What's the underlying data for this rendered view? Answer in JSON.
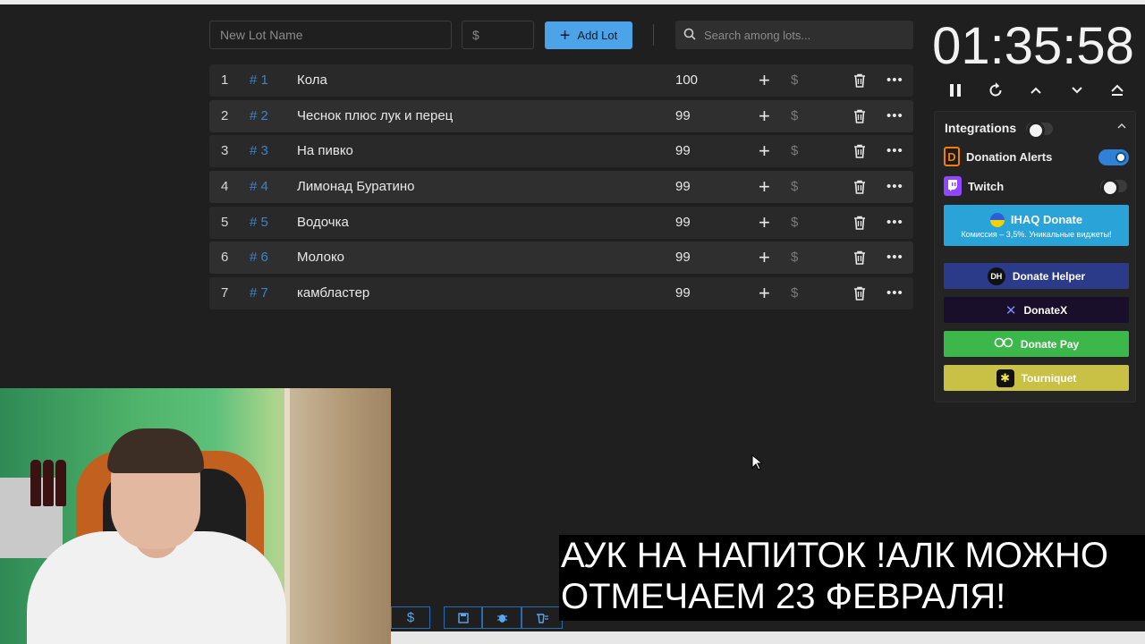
{
  "form": {
    "lot_name_placeholder": "New Lot Name",
    "price_placeholder": "$",
    "add_lot_label": "Add Lot",
    "search_placeholder": "Search among lots..."
  },
  "lots": [
    {
      "index": "1",
      "id": "# 1",
      "name": "Кола",
      "amount": "100"
    },
    {
      "index": "2",
      "id": "# 2",
      "name": "Чеснок плюс лук и перец",
      "amount": "99"
    },
    {
      "index": "3",
      "id": "# 3",
      "name": "На пивко",
      "amount": "99"
    },
    {
      "index": "4",
      "id": "# 4",
      "name": "Лимонад Буратино",
      "amount": "99"
    },
    {
      "index": "5",
      "id": "# 5",
      "name": "Водочка",
      "amount": "99"
    },
    {
      "index": "6",
      "id": "# 6",
      "name": "Молоко",
      "amount": "99"
    },
    {
      "index": "7",
      "id": "# 7",
      "name": "камбластер",
      "amount": "99"
    }
  ],
  "timer": {
    "display": "01:35:58"
  },
  "integrations": {
    "title": "Integrations",
    "enabled": false,
    "services": [
      {
        "name": "Donation Alerts",
        "enabled": true,
        "color": "#f57d07"
      },
      {
        "name": "Twitch",
        "enabled": false,
        "color": "#9146ff"
      }
    ],
    "donate_buttons": [
      {
        "label": "IHAQ Donate",
        "sub": "Комиссия – 3,5%. Уникальные виджеты!",
        "color": "#2aa3d8"
      },
      {
        "label": "Donate Helper",
        "color": "#2c3a8a"
      },
      {
        "label": "DonateX",
        "color": "#1a0f2a"
      },
      {
        "label": "Donate Pay",
        "color": "#3cb84b"
      },
      {
        "label": "Tourniquet",
        "color": "#c9c145"
      }
    ]
  },
  "bottom_toolbar": {
    "dollar_label": "$"
  },
  "caption": {
    "line1": "АУК НА НАПИТОК !АЛК МОЖНО",
    "line2": "ОТМЕЧАЕМ 23 ФЕВРАЛЯ!"
  },
  "colors": {
    "accent": "#4da3e8",
    "background": "#1f1f1f",
    "lot_id": "#3a83c8"
  }
}
